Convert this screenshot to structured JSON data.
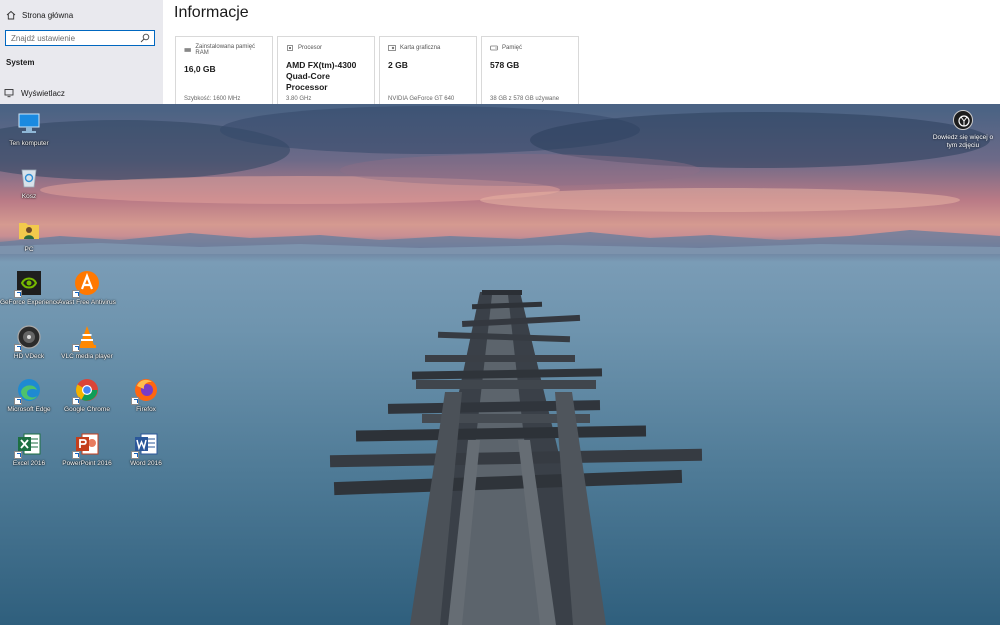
{
  "settings": {
    "nav": {
      "home_label": "Strona główna",
      "search_placeholder": "Znajdź ustawienie",
      "section_label": "System",
      "display_label": "Wyświetlacz"
    },
    "page_title": "Informacje",
    "cards": [
      {
        "icon": "ram-icon",
        "label": "Zainstalowana pamięć RAM",
        "value": "16,0 GB",
        "sub": "Szybkość: 1600 MHz"
      },
      {
        "icon": "processor-icon",
        "label": "Procesor",
        "value": "AMD FX(tm)-4300 Quad-Core Processor",
        "sub": "3.80 GHz"
      },
      {
        "icon": "graphics-card-icon",
        "label": "Karta graficzna",
        "value": "2 GB",
        "sub": "NVIDIA GeForce GT 640"
      },
      {
        "icon": "storage-icon",
        "label": "Pamięć",
        "value": "578 GB",
        "sub": "38 GB z 578 GB używane"
      }
    ]
  },
  "desktop": {
    "icons": {
      "this_pc": "Ten komputer",
      "recycle_bin": "Kosz",
      "user_folder": "PC",
      "geforce": "GeForce Experience",
      "avast": "Avast Free Antivirus",
      "hd_vdeck": "HD VDeck",
      "vlc": "VLC media player",
      "edge": "Microsoft Edge",
      "chrome": "Google Chrome",
      "firefox": "Firefox",
      "excel": "Excel 2016",
      "powerpoint": "PowerPoint 2016",
      "word": "Word 2016"
    },
    "about_photo": "Dowiedz się więcej o tym zdjęciu"
  },
  "colors": {
    "accent": "#0067c0",
    "nav_bg": "#e9e9ee",
    "geforce": "#76b900",
    "avast": "#ff7800",
    "excel": "#1d6f42",
    "powerpoint": "#c43e1c",
    "word": "#2b579a"
  }
}
